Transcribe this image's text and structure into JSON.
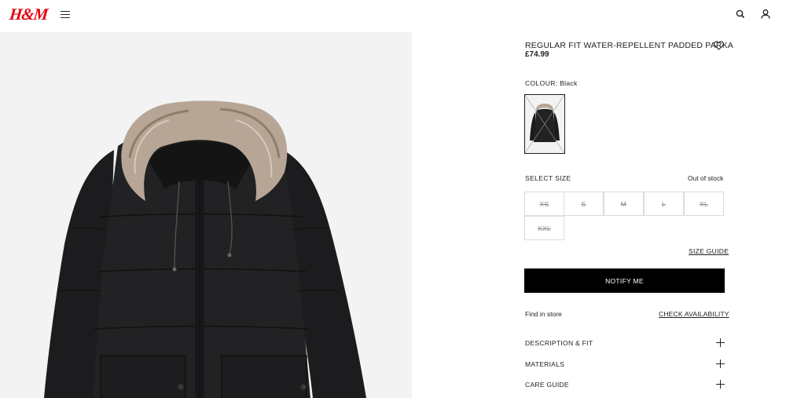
{
  "header": {
    "logo": "H&M",
    "menu_icon": "hamburger-icon",
    "search_icon": "search-icon",
    "account_icon": "account-icon"
  },
  "product": {
    "title": "REGULAR FIT WATER-REPELLENT PADDED PARKA",
    "price": "£74.99",
    "favourite_icon": "heart-icon",
    "colour_label": "COLOUR:",
    "colour_value": "Black",
    "image_alt_icon": "parka-image"
  },
  "size_selector": {
    "label": "SELECT SIZE",
    "stock_status": "Out of stock",
    "sizes": [
      "XS",
      "S",
      "M",
      "L",
      "XL",
      "XXL"
    ],
    "size_guide": "SIZE GUIDE"
  },
  "actions": {
    "notify_me": "NOTIFY ME",
    "find_in_store": "Find in store",
    "check_availability": "CHECK AVAILABILITY"
  },
  "accordion": [
    {
      "label": "DESCRIPTION & FIT"
    },
    {
      "label": "MATERIALS"
    },
    {
      "label": "CARE GUIDE"
    }
  ],
  "colors": {
    "brand_red": "#e50010",
    "button_black": "#000000",
    "unavailable_text": "#8a8a8a"
  }
}
